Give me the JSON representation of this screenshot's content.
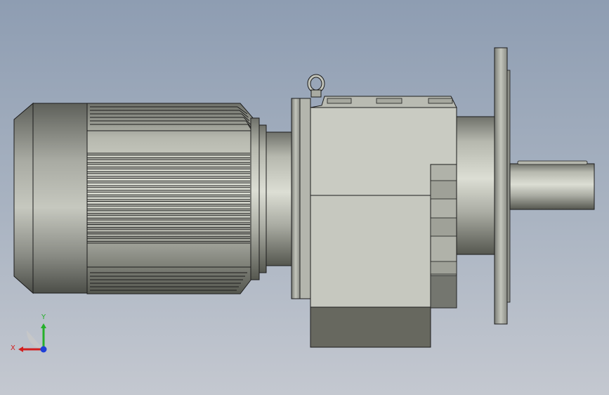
{
  "viewport": {
    "background_top": "#8e9db2",
    "background_bottom": "#c4c8d0"
  },
  "model": {
    "body_color": "#c9cbc2",
    "shadow_color": "#6b6c66",
    "edge_color": "#1c1c1c"
  },
  "triad": {
    "x_label": "X",
    "y_label": "Y",
    "x_color": "#d21f1f",
    "y_color": "#25b02a",
    "z_color": "#1e3fd8"
  }
}
